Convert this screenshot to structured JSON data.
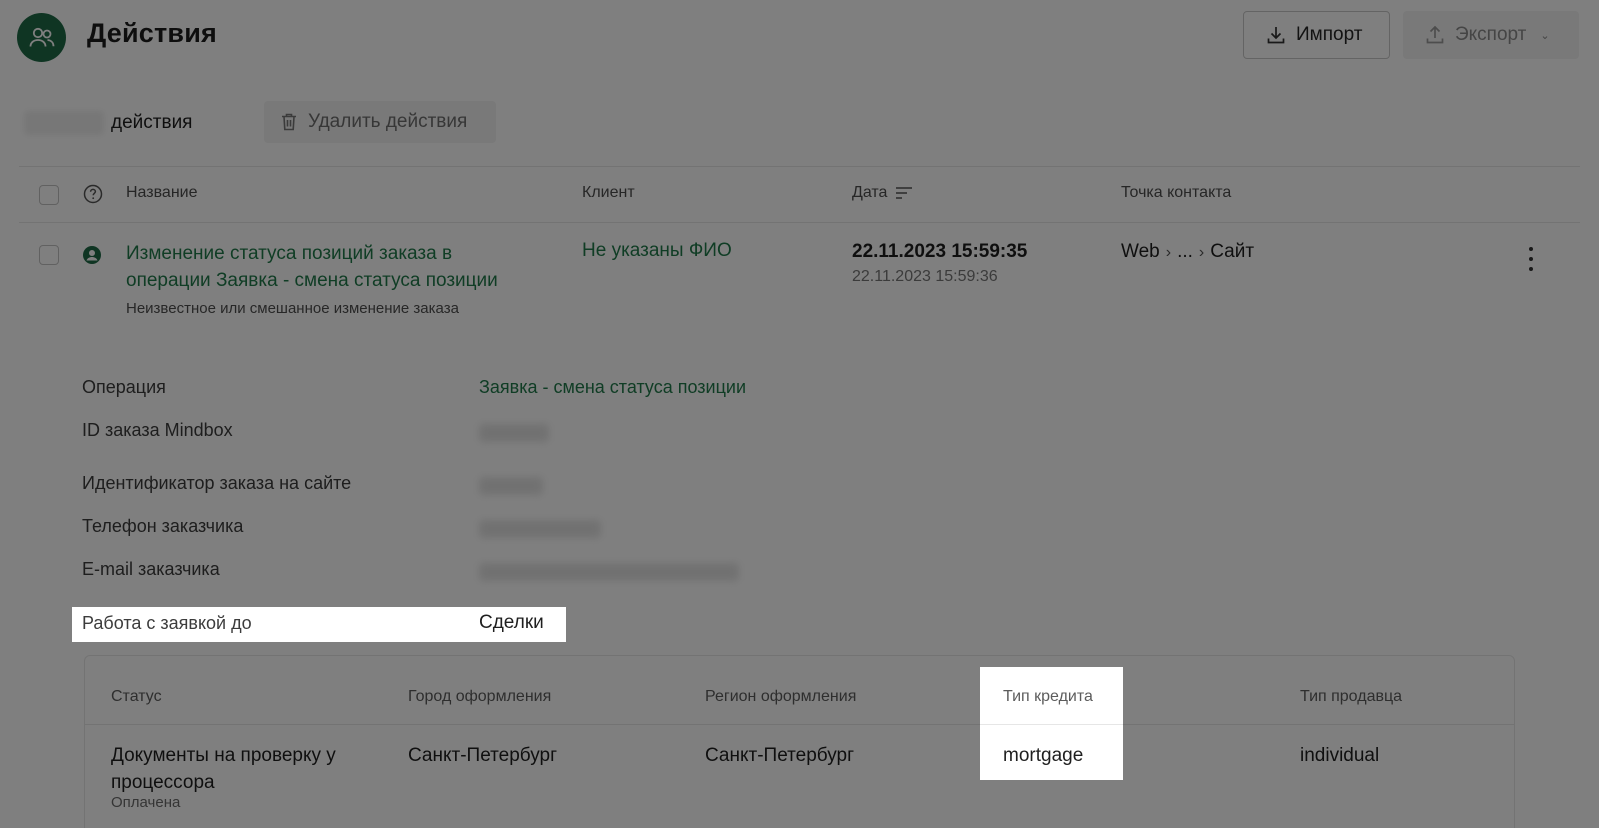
{
  "header": {
    "title": "Действия",
    "import_label": "Импорт",
    "export_label": "Экспорт"
  },
  "toolbar": {
    "selected_label": "действия",
    "delete_label": "Удалить действия"
  },
  "table": {
    "columns": [
      "Название",
      "Клиент",
      "Дата",
      "Точка контакта"
    ],
    "row": {
      "title_line1": "Изменение статуса позиций заказа в",
      "title_line2": "операции Заявка - смена статуса позиции",
      "subtitle": "Неизвестное или смешанное изменение заказа",
      "client": "Не указаны ФИО",
      "date_main": "22.11.2023 15:59:35",
      "date_sub": "22.11.2023 15:59:36",
      "contact_start": "Web",
      "contact_mid": "...",
      "contact_end": "Сайт"
    }
  },
  "details": {
    "operation_label": "Операция",
    "operation_value": "Заявка - смена статуса позиции",
    "mindbox_id_label": "ID заказа Mindbox",
    "site_id_label": "Идентификатор заказа на сайте",
    "phone_label": "Телефон заказчика",
    "email_label": "E-mail заказчика",
    "work_label": "Работа с заявкой до",
    "work_value": "Сделки"
  },
  "nested_table": {
    "columns": [
      "Статус",
      "Город оформления",
      "Регион оформления",
      "Тип кредита",
      "Тип продавца"
    ],
    "row": {
      "status_line1": "Документы на проверку у",
      "status_line2": "процессора",
      "status_sub": "Оплачена",
      "city": "Санкт-Петербург",
      "region": "Санкт-Петербург",
      "credit_type": "mortgage",
      "seller_type": "individual"
    }
  },
  "colors": {
    "accent": "#207a4a",
    "logo": "#1f6a46"
  }
}
